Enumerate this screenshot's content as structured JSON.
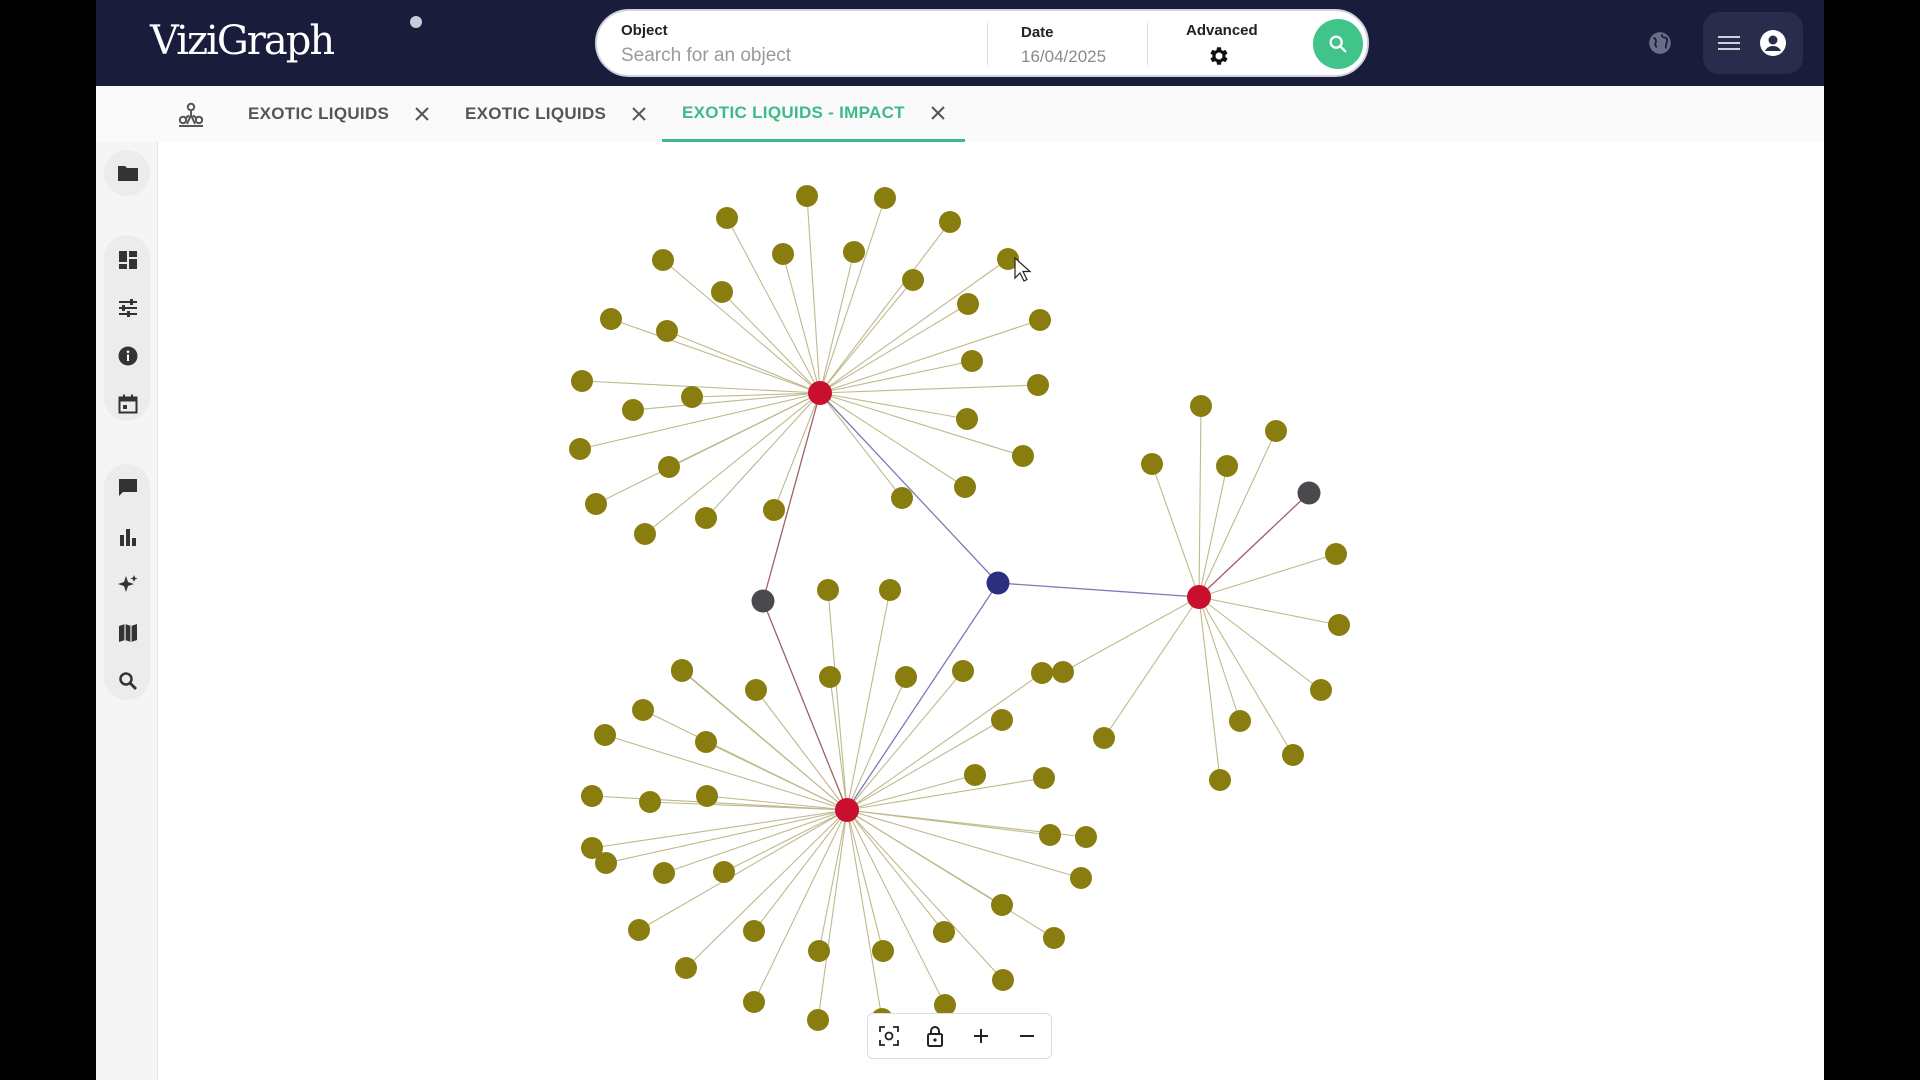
{
  "app": {
    "logo_text": "ViziGraph"
  },
  "search": {
    "object_label": "Object",
    "object_placeholder": "Search for an object",
    "date_label": "Date",
    "date_value": "16/04/2025",
    "advanced_label": "Advanced"
  },
  "tabs": [
    {
      "label": "EXOTIC LIQUIDS",
      "active": false
    },
    {
      "label": "EXOTIC LIQUIDS",
      "active": false
    },
    {
      "label": "EXOTIC LIQUIDS - IMPACT",
      "active": true
    }
  ],
  "graph": {
    "colors": {
      "leaf": "#8a7d10",
      "hub": "#c8102e",
      "center": "#2b2f80",
      "grey_node": "#4a4a4e",
      "edge_order": "#bfb98c",
      "edge_supplier": "#7b7bb5",
      "edge_part_of": "#a06060"
    }
  }
}
